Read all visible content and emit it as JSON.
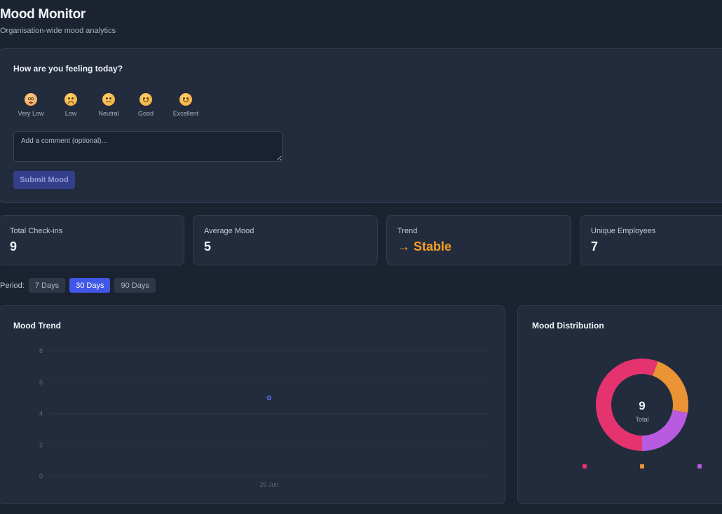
{
  "header": {
    "title": "Mood Monitor",
    "subtitle": "Organisation-wide mood analytics"
  },
  "mood_form": {
    "question": "How are you feeling today?",
    "options": [
      {
        "label": "Very Low",
        "icon": "anxious-face-icon"
      },
      {
        "label": "Low",
        "icon": "pensive-face-icon"
      },
      {
        "label": "Neutral",
        "icon": "neutral-face-icon"
      },
      {
        "label": "Good",
        "icon": "slightly-smiling-face-icon"
      },
      {
        "label": "Excellent",
        "icon": "smiling-face-icon"
      }
    ],
    "comment_placeholder": "Add a comment (optional)...",
    "submit_label": "Submit Mood"
  },
  "stats": [
    {
      "label": "Total Check-ins",
      "value": "9"
    },
    {
      "label": "Average Mood",
      "value": "5"
    },
    {
      "label": "Trend",
      "value": "→ Stable",
      "color": "#f59e25"
    },
    {
      "label": "Unique Employees",
      "value": "7"
    }
  ],
  "period": {
    "label": "Period:",
    "options": [
      "7 Days",
      "30 Days",
      "90 Days"
    ],
    "selected": "30 Days"
  },
  "chart_data": [
    {
      "type": "line",
      "title": "Mood Trend",
      "x": [
        "26 Jun"
      ],
      "series": [
        {
          "values": [
            5
          ],
          "color": "#5b6cf0"
        }
      ],
      "ylim": [
        0,
        8
      ],
      "yticks": [
        0,
        2,
        4,
        6,
        8
      ],
      "grid": true
    },
    {
      "type": "pie",
      "title": "Mood Distribution",
      "donut": true,
      "center_value": "9",
      "center_label": "Total",
      "values": [
        5,
        2,
        2
      ],
      "colors": [
        "#e5336f",
        "#ea9435",
        "#b85be0"
      ],
      "legend": "bottom"
    }
  ]
}
